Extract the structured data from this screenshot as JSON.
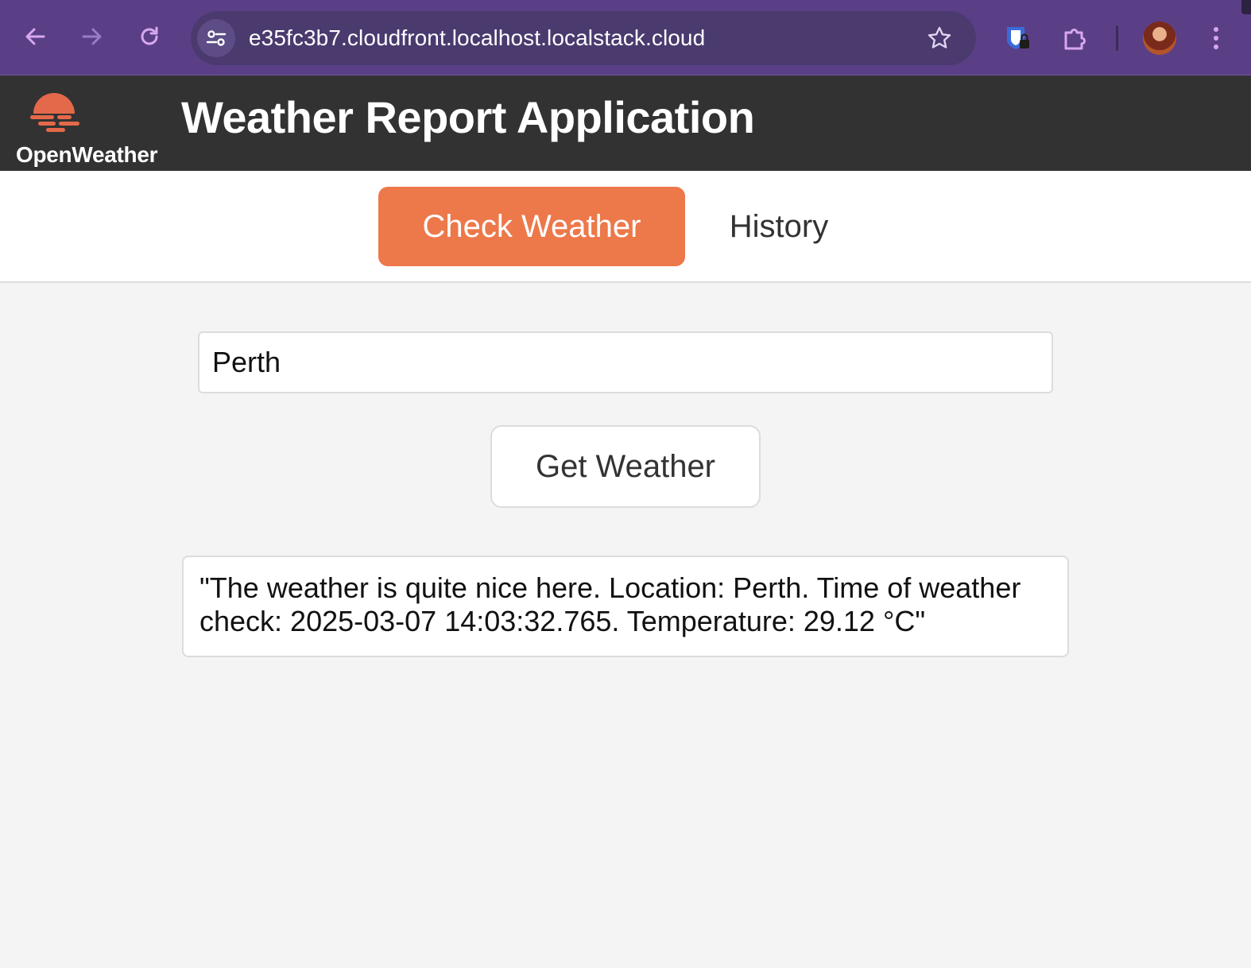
{
  "browser": {
    "url": "e35fc3b7.cloudfront.localhost.localstack.cloud",
    "icons": [
      "back-arrow-icon",
      "forward-arrow-icon",
      "reload-icon",
      "site-info-icon",
      "bookmark-star-icon",
      "password-manager-icon",
      "extensions-icon",
      "profile-avatar",
      "more-menu-icon"
    ],
    "accent_color": "#5b3f86"
  },
  "header": {
    "logo_text": "OpenWeather",
    "title": "Weather Report Application",
    "background": "#323232",
    "logo_color": "#e4694a"
  },
  "tabs": [
    {
      "label": "Check Weather",
      "active": true
    },
    {
      "label": "History",
      "active": false
    }
  ],
  "tab_active_color": "#ed784a",
  "form": {
    "city_value": "Perth",
    "submit_label": "Get Weather"
  },
  "result": {
    "text": "\"The weather is quite nice here. Location: Perth. Time of weather check: 2025-03-07 14:03:32.765. Temperature: 29.12 °C\""
  }
}
